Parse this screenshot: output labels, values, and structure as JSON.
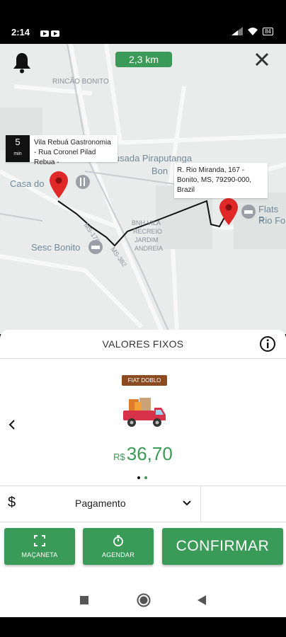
{
  "status_bar": {
    "time": "2:14",
    "battery": "84"
  },
  "map": {
    "distance": "2,3 km",
    "origin": {
      "eta_value": "5",
      "eta_unit": "min",
      "address": "Vila Rebuá Gastronomia - Rua Coronel Pilad Rebua -"
    },
    "destination": {
      "address": "R. Rio Miranda, 167 - Bonito, MS, 79290-000, Brazil"
    },
    "labels": {
      "rincao": "RINCÃO BONITO",
      "pousada": "Pousada Piraputanga",
      "bon": "Bon",
      "casa": "Casa do",
      "flats1": "Flats P",
      "flats2": "Rio Fo",
      "sesc": "Sesc Bonito",
      "bnh1": "BNH VILA",
      "bnh2": "RECREIO",
      "bnh3": "JARDIM",
      "bnh4": "ANDREIA",
      "road1": "MS-178",
      "road2": "MS-382"
    }
  },
  "sheet": {
    "title": "VALORES FIXOS",
    "vehicle": "FIAT DOBLO",
    "price_currency": "R$",
    "price_value": "36,70",
    "payment_label": "Pagamento",
    "payment_symbol": "$",
    "buttons": {
      "manivela": "MAÇANETA",
      "agendar": "AGENDAR",
      "confirm": "CONFIRMAR"
    }
  },
  "colors": {
    "accent": "#3a9a57",
    "pin": "#e02828",
    "vehicle_tag": "#8b4a1f"
  }
}
